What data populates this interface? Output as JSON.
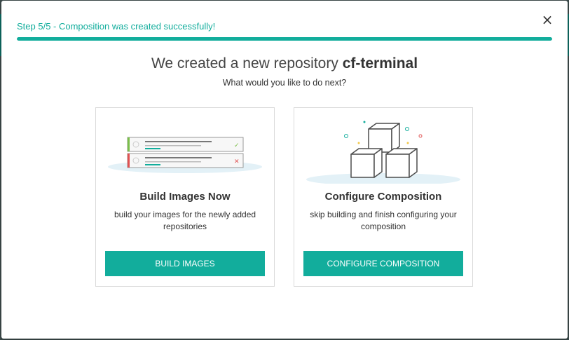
{
  "step": {
    "text": "Step 5/5 - Composition was created successfully!",
    "progress_fraction": 1.0
  },
  "close": {
    "icon": "close-icon",
    "glyph": "×"
  },
  "headline": {
    "prefix": "We created a new repository ",
    "repo_name": "cf-terminal"
  },
  "subheadline": "What would you like to do next?",
  "cards": [
    {
      "title": "Build Images Now",
      "description": "build your images for the newly added repositories",
      "button_label": "BUILD IMAGES",
      "illustration": "build-list-illustration"
    },
    {
      "title": "Configure Composition",
      "description": "skip building and finish configuring your composition",
      "button_label": "CONFIGURE COMPOSITION",
      "illustration": "stacked-boxes-illustration"
    }
  ],
  "colors": {
    "accent": "#12ad9c",
    "success": "#7bbf4a",
    "error": "#e05252"
  }
}
